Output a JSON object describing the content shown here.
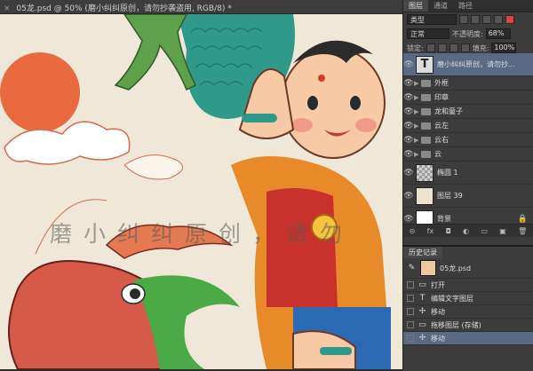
{
  "document": {
    "close_glyph": "×",
    "tab_title": "05龙.psd @ 50% (磨小纠纠原创，请勿抄袭盗用, RGB/8) *"
  },
  "artwork": {
    "watermark": "磨小纠纠原创，请勿"
  },
  "layers_panel": {
    "tabs": [
      "图层",
      "通道",
      "路径"
    ],
    "filter_label": "类型",
    "blend_mode": "正常",
    "opacity_label": "不透明度:",
    "opacity_value": "68%",
    "lock_label": "锁定:",
    "fill_label": "填充:",
    "fill_value": "100%",
    "layers": [
      {
        "name": "磨小纠纠原创，请勿抄...",
        "kind": "text",
        "selected": true
      },
      {
        "name": "外框",
        "kind": "group"
      },
      {
        "name": "印章",
        "kind": "group"
      },
      {
        "name": "龙和童子",
        "kind": "group"
      },
      {
        "name": "云左",
        "kind": "group"
      },
      {
        "name": "云右",
        "kind": "group"
      },
      {
        "name": "云",
        "kind": "group"
      },
      {
        "name": "椭圆 1",
        "kind": "shape"
      },
      {
        "name": "图层 39",
        "kind": "pixel"
      },
      {
        "name": "背景",
        "kind": "background",
        "locked": true
      }
    ],
    "footer_icons": [
      "link-icon",
      "fx-icon",
      "mask-icon",
      "adjustment-icon",
      "folder-icon",
      "new-layer-icon",
      "trash-icon"
    ],
    "footer_glyphs": [
      "⊝",
      "fx",
      "◘",
      "◐",
      "▭",
      "▣",
      "🗑"
    ]
  },
  "history_panel": {
    "title": "历史记录",
    "snapshot": "05龙.psd",
    "items": [
      {
        "name": "打开",
        "icon": "file-icon",
        "glyph": "▭"
      },
      {
        "name": "编辑文字图层",
        "icon": "text-icon",
        "glyph": "T"
      },
      {
        "name": "移动",
        "icon": "move-icon",
        "glyph": "✢"
      },
      {
        "name": "拖移图层 (存储)",
        "icon": "file-icon",
        "glyph": "▭"
      },
      {
        "name": "移动",
        "icon": "move-icon",
        "glyph": "✢",
        "selected": true
      }
    ]
  },
  "colors": {
    "selection": "#5a6a82",
    "panel_bg": "#3c3c3c",
    "canvas_bg": "#efe7d8"
  }
}
